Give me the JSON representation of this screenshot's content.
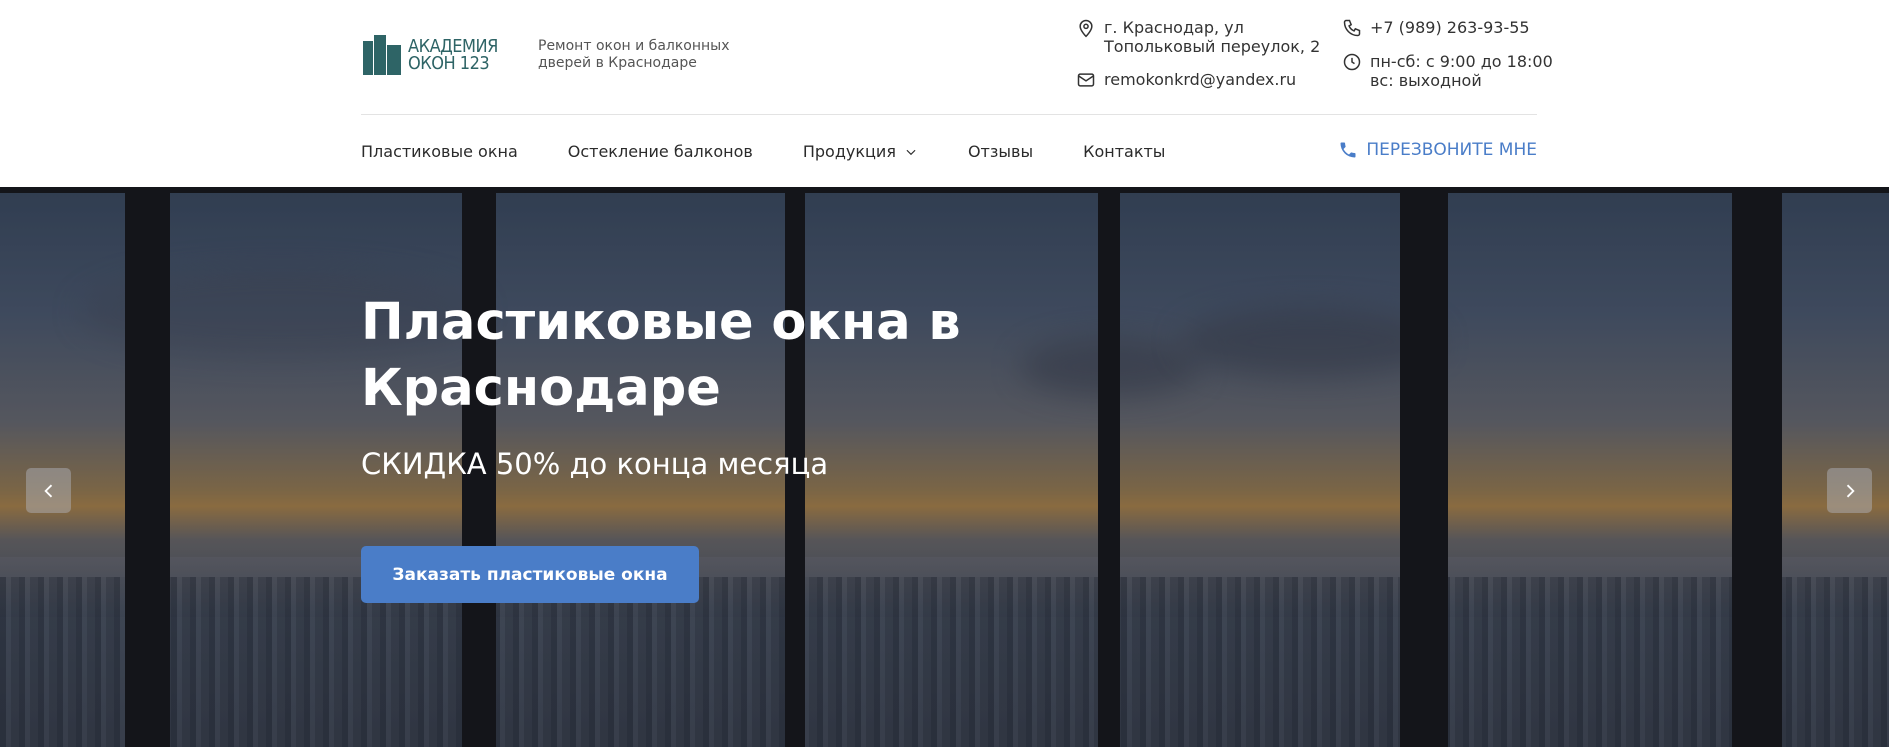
{
  "brand": {
    "logo_line1": "АКАДЕМИЯ",
    "logo_line2": "ОКОН 123",
    "tagline": "Ремонт окон и балконных дверей в Краснодаре",
    "color": "#2e6466"
  },
  "contacts": {
    "address_line1": "г. Краснодар, ул",
    "address_line2": "Топольковый переулок, 2",
    "email": "remokonkrd@yandex.ru",
    "phone": "+7 (989) 263-93-55",
    "hours_line1": "пн-сб: с 9:00 до 18:00",
    "hours_line2": "вс: выходной",
    "icons": [
      "location-icon",
      "mail-icon",
      "phone-icon",
      "clock-icon"
    ]
  },
  "nav": {
    "items": [
      {
        "label": "Пластиковые окна"
      },
      {
        "label": "Остекление балконов"
      },
      {
        "label": "Продукция",
        "has_dropdown": true
      },
      {
        "label": "Отзывы"
      },
      {
        "label": "Контакты"
      }
    ],
    "callback_label": "ПЕРЕЗВОНИТЕ МНЕ"
  },
  "hero": {
    "title_line1": "Пластиковые окна в",
    "title_line2": "Краснодаре",
    "subtitle": "СКИДКА 50% до конца месяца",
    "button_label": "Заказать пластиковые окна",
    "prev_icon": "chevron-left-icon",
    "next_icon": "chevron-right-icon"
  },
  "colors": {
    "accent": "#4a7dc8",
    "text": "#2b2b2b"
  }
}
